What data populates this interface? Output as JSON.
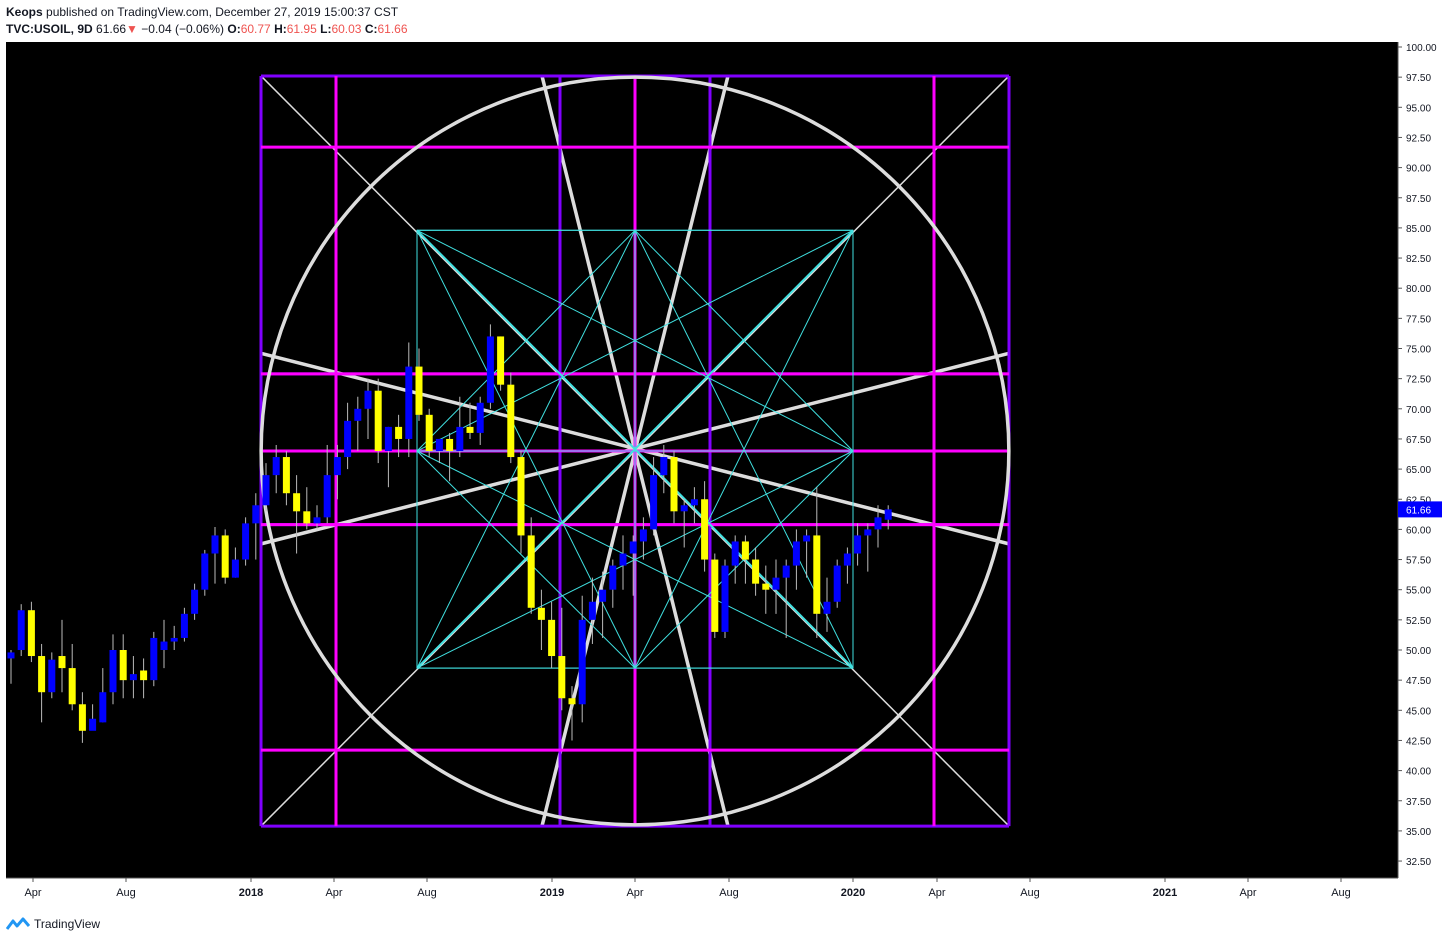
{
  "header": {
    "author": "Keops",
    "published_text": "published on TradingView.com, December 27, 2019 15:00:37 CST",
    "symbol": "TVC:USOIL, 9D",
    "last": "61.66",
    "change": "−0.04 (−0.06%)",
    "o_label": "O:",
    "o_value": "60.77",
    "h_label": "H:",
    "h_value": "61.95",
    "l_label": "L:",
    "l_value": "60.03",
    "c_label": "C:",
    "c_value": "61.66"
  },
  "footer": {
    "brand": "TradingView"
  },
  "colors": {
    "background": "#000000",
    "bull": "#0000ff",
    "bear": "#ffff00",
    "purple": "#8000ff",
    "magenta": "#ff00ff",
    "cyan": "#40e0e0",
    "white": "#e0e0e0",
    "price_label": "#0000ff"
  },
  "chart_data": {
    "type": "candlestick",
    "symbol": "TVC:USOIL",
    "interval": "9D",
    "y_ticks": [
      "100.00",
      "97.50",
      "95.00",
      "92.50",
      "90.00",
      "87.50",
      "85.00",
      "82.50",
      "80.00",
      "77.50",
      "75.00",
      "72.50",
      "70.00",
      "67.50",
      "65.00",
      "62.50",
      "60.00",
      "57.50",
      "55.00",
      "52.50",
      "50.00",
      "47.50",
      "45.00",
      "42.50",
      "40.00",
      "37.50",
      "35.00",
      "32.50"
    ],
    "ylim": [
      31,
      100.5
    ],
    "x_ticks": [
      {
        "label": "Apr",
        "bold": false
      },
      {
        "label": "Aug",
        "bold": false
      },
      {
        "label": "2018",
        "bold": true
      },
      {
        "label": "Apr",
        "bold": false
      },
      {
        "label": "Aug",
        "bold": false
      },
      {
        "label": "2019",
        "bold": true
      },
      {
        "label": "Apr",
        "bold": false
      },
      {
        "label": "Aug",
        "bold": false
      },
      {
        "label": "2020",
        "bold": true
      },
      {
        "label": "Apr",
        "bold": false
      },
      {
        "label": "Aug",
        "bold": false
      },
      {
        "label": "2021",
        "bold": true
      },
      {
        "label": "Apr",
        "bold": false
      },
      {
        "label": "Aug",
        "bold": false
      }
    ],
    "last_price_label": "61.66",
    "last_price": 61.66,
    "candles": [
      [
        49.3,
        49.8,
        47.2,
        50.0
      ],
      [
        50.0,
        53.3,
        49.5,
        53.8
      ],
      [
        53.3,
        49.5,
        49.0,
        54.0
      ],
      [
        49.5,
        46.5,
        44.0,
        50.5
      ],
      [
        46.5,
        49.2,
        46.0,
        49.8
      ],
      [
        49.5,
        48.5,
        46.5,
        52.5
      ],
      [
        48.5,
        45.5,
        45.0,
        50.5
      ],
      [
        45.5,
        43.3,
        42.3,
        46.5
      ],
      [
        43.3,
        44.3,
        43.5,
        45.5
      ],
      [
        44.0,
        46.5,
        44.0,
        48.5
      ],
      [
        46.5,
        50.0,
        45.5,
        51.3
      ],
      [
        50.0,
        47.5,
        46.0,
        51.3
      ],
      [
        47.5,
        48.0,
        46.0,
        49.5
      ],
      [
        48.3,
        47.5,
        46.0,
        49.3
      ],
      [
        47.5,
        51.0,
        47.0,
        51.5
      ],
      [
        50.0,
        50.7,
        48.5,
        52.5
      ],
      [
        50.7,
        51.0,
        50.0,
        52.0
      ],
      [
        51.0,
        53.0,
        50.7,
        53.5
      ],
      [
        53.0,
        55.0,
        52.5,
        55.5
      ],
      [
        55.0,
        58.0,
        54.5,
        58.3
      ],
      [
        58.0,
        59.5,
        55.5,
        60.2
      ],
      [
        59.5,
        56.0,
        55.5,
        60.0
      ],
      [
        56.0,
        57.5,
        56.0,
        58.5
      ],
      [
        57.5,
        60.5,
        57.0,
        61.0
      ],
      [
        60.5,
        62.0,
        57.5,
        63.0
      ],
      [
        62.0,
        64.5,
        61.5,
        65.5
      ],
      [
        64.5,
        66.0,
        63.0,
        67.0
      ],
      [
        66.0,
        63.0,
        62.0,
        66.5
      ],
      [
        63.0,
        61.5,
        58.0,
        64.5
      ],
      [
        61.5,
        60.5,
        60.0,
        63.5
      ],
      [
        60.5,
        61.0,
        60.0,
        62.0
      ],
      [
        61.0,
        64.5,
        60.5,
        67.0
      ],
      [
        64.5,
        66.0,
        62.5,
        67.0
      ],
      [
        66.0,
        69.0,
        65.0,
        70.5
      ],
      [
        69.0,
        70.0,
        66.5,
        71.0
      ],
      [
        70.0,
        71.5,
        67.5,
        72.5
      ],
      [
        71.5,
        66.5,
        65.5,
        72.5
      ],
      [
        66.5,
        68.5,
        63.5,
        68.5
      ],
      [
        68.5,
        67.5,
        66.0,
        69.5
      ],
      [
        67.5,
        73.5,
        66.0,
        75.5
      ],
      [
        73.5,
        69.5,
        69.0,
        75.0
      ],
      [
        69.5,
        66.5,
        66.0,
        70.0
      ],
      [
        66.5,
        67.5,
        65.5,
        67.5
      ],
      [
        67.5,
        66.5,
        64.0,
        68.0
      ],
      [
        66.5,
        68.5,
        66.0,
        71.0
      ],
      [
        68.5,
        68.0,
        67.5,
        70.5
      ],
      [
        68.0,
        70.5,
        67.0,
        71.0
      ],
      [
        70.5,
        76.0,
        70.0,
        77.0
      ],
      [
        76.0,
        72.0,
        71.5,
        76.0
      ],
      [
        72.0,
        66.0,
        65.5,
        73.0
      ],
      [
        66.0,
        59.5,
        58.0,
        66.5
      ],
      [
        59.5,
        53.5,
        53.0,
        61.0
      ],
      [
        53.5,
        52.5,
        50.0,
        55.0
      ],
      [
        52.5,
        49.5,
        48.5,
        54.0
      ],
      [
        49.5,
        46.0,
        45.0,
        53.5
      ],
      [
        46.0,
        45.5,
        42.5,
        47.0
      ],
      [
        45.5,
        52.5,
        44.0,
        54.5
      ],
      [
        52.5,
        54.0,
        50.5,
        56.0
      ],
      [
        54.0,
        55.0,
        51.0,
        56.5
      ],
      [
        55.0,
        57.0,
        53.5,
        57.5
      ],
      [
        57.0,
        58.0,
        55.0,
        59.5
      ],
      [
        58.0,
        59.0,
        54.5,
        59.5
      ],
      [
        59.0,
        60.0,
        57.5,
        61.0
      ],
      [
        60.0,
        64.5,
        59.5,
        66.0
      ],
      [
        64.5,
        66.0,
        63.0,
        67.0
      ],
      [
        66.0,
        61.5,
        60.5,
        66.5
      ],
      [
        61.5,
        62.0,
        58.5,
        62.5
      ],
      [
        62.0,
        62.5,
        60.5,
        63.5
      ],
      [
        62.5,
        57.5,
        56.5,
        64.0
      ],
      [
        57.5,
        51.5,
        51.0,
        58.0
      ],
      [
        51.5,
        57.0,
        51.0,
        57.5
      ],
      [
        57.0,
        59.0,
        55.5,
        59.5
      ],
      [
        59.0,
        57.5,
        55.5,
        59.5
      ],
      [
        57.5,
        55.5,
        54.5,
        58.5
      ],
      [
        55.5,
        55.0,
        53.0,
        57.0
      ],
      [
        55.0,
        56.0,
        53.0,
        57.5
      ],
      [
        56.0,
        57.0,
        51.0,
        57.5
      ],
      [
        57.0,
        59.0,
        55.0,
        60.0
      ],
      [
        59.0,
        59.5,
        56.0,
        60.0
      ],
      [
        59.5,
        53.0,
        51.0,
        63.5
      ],
      [
        53.0,
        54.0,
        51.5,
        56.0
      ],
      [
        54.0,
        57.0,
        53.5,
        57.5
      ],
      [
        57.0,
        58.0,
        55.5,
        58.5
      ],
      [
        58.0,
        59.5,
        57.0,
        60.5
      ],
      [
        59.5,
        60.0,
        56.5,
        60.5
      ],
      [
        60.0,
        61.0,
        58.5,
        62.0
      ],
      [
        60.8,
        61.66,
        60.0,
        62.0
      ]
    ],
    "overlay": {
      "square": {
        "price_top": 97.6,
        "price_bottom": 35.4
      },
      "circle": {
        "center_price": 66.5,
        "radius_price": 31.0
      },
      "magenta_levels": [
        91.7,
        72.9,
        66.5,
        60.4,
        41.7
      ],
      "purple_levels": [
        97.6,
        72.9,
        60.4,
        35.4
      ],
      "inner_square": {
        "price_top": 84.8,
        "price_bottom": 48.5
      },
      "center_price": 66.5
    }
  }
}
